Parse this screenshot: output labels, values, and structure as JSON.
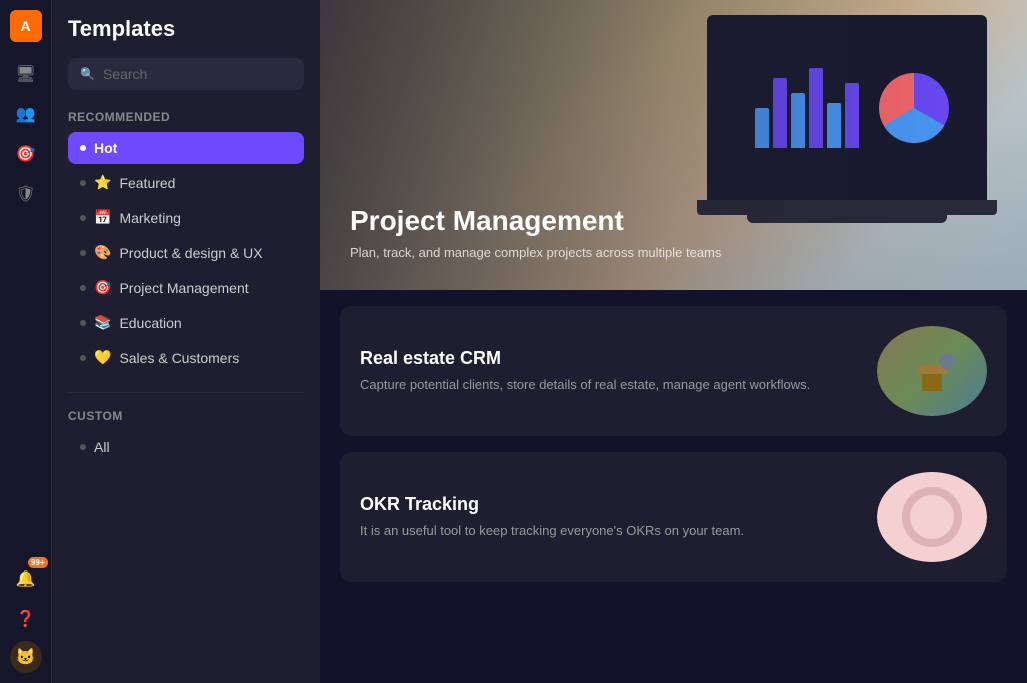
{
  "app": {
    "user_initial": "A",
    "title": "Templates"
  },
  "icon_bar": {
    "icons": [
      {
        "name": "monitor-icon",
        "glyph": "🖥",
        "active": false
      },
      {
        "name": "users-icon",
        "glyph": "👥",
        "active": false
      },
      {
        "name": "target-icon",
        "glyph": "🎯",
        "active": true
      },
      {
        "name": "shield-icon",
        "glyph": "🛡",
        "active": false
      }
    ],
    "bottom_icons": [
      {
        "name": "bell-icon",
        "glyph": "🔔",
        "badge": "99+"
      },
      {
        "name": "help-icon",
        "glyph": "❓"
      },
      {
        "name": "user-avatar-icon",
        "glyph": "🐱"
      }
    ]
  },
  "search": {
    "placeholder": "Search"
  },
  "sidebar": {
    "recommended_label": "Recommended",
    "custom_label": "Custom",
    "items": [
      {
        "label": "Hot",
        "icon": "",
        "active": true
      },
      {
        "label": "Featured",
        "icon": "⭐",
        "active": false
      },
      {
        "label": "Marketing",
        "icon": "📅",
        "active": false
      },
      {
        "label": "Product & design & UX",
        "icon": "🎨",
        "active": false
      },
      {
        "label": "Project Management",
        "icon": "🎯",
        "active": false
      },
      {
        "label": "Education",
        "icon": "📚",
        "active": false
      },
      {
        "label": "Sales & Customers",
        "icon": "💛",
        "active": false
      }
    ],
    "custom_items": [
      {
        "label": "All",
        "icon": ""
      }
    ]
  },
  "featured_banner": {
    "title": "Project Management",
    "description": "Plan, track, and manage complex projects across multiple teams"
  },
  "cards": [
    {
      "title": "Real estate CRM",
      "description": "Capture potential clients, store details of real estate, manage agent workflows.",
      "thumb_type": "real-estate"
    },
    {
      "title": "OKR Tracking",
      "description": "It is an useful tool to keep tracking everyone's OKRs on your team.",
      "thumb_type": "okr"
    }
  ]
}
